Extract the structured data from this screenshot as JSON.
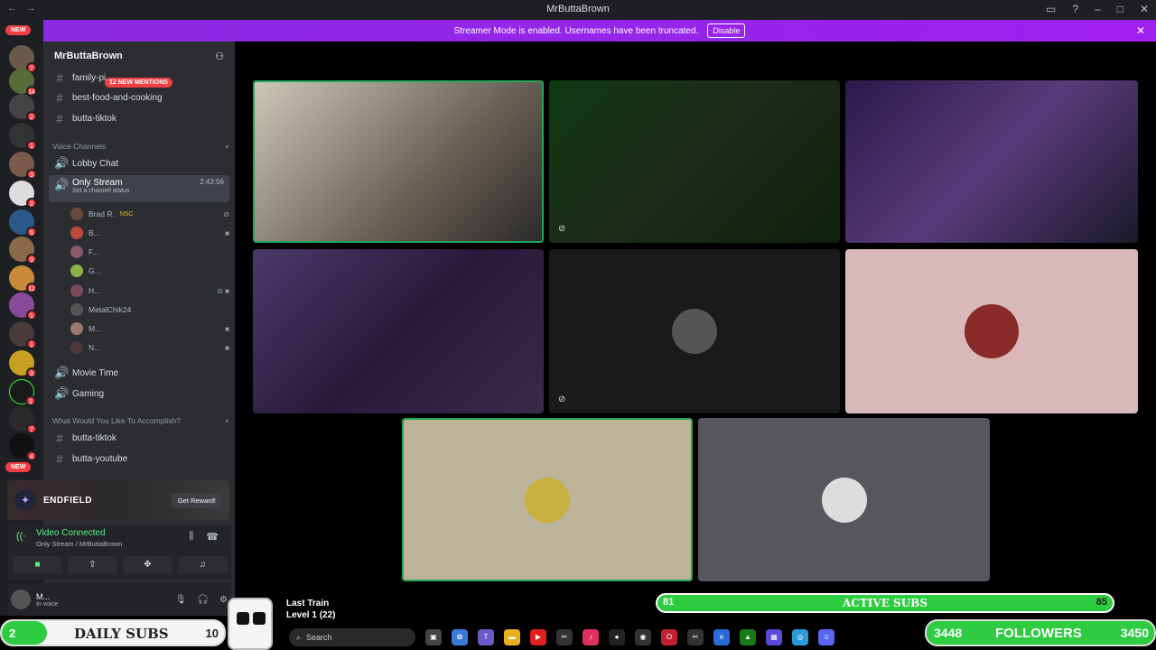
{
  "window": {
    "title": "MrButtaBrown"
  },
  "banner": {
    "text": "Streamer Mode is enabled. Usernames have been truncated.",
    "disable_label": "Disable"
  },
  "servers": {
    "new_label": "NEW",
    "badges": [
      "7",
      "14",
      "2",
      "1",
      "3",
      "2",
      "5",
      "3",
      "12",
      "1",
      "1",
      "3",
      "1",
      "7",
      "4"
    ]
  },
  "guild": {
    "name": "MrButtaBrown"
  },
  "mentions_pill": "12 NEW MENTIONS",
  "channels": {
    "top": [
      "family-pi...",
      "best-food-and-cooking",
      "butta-tiktok"
    ],
    "voice_category": "Voice Channels",
    "lobby": "Lobby Chat",
    "only_stream": "Only Stream",
    "only_stream_status": "Set a channel status",
    "only_stream_time": "2:43:56",
    "voice_users": [
      "Brad R.",
      "B...",
      "F...",
      "G...",
      "H...",
      "MetalChik24",
      "M...",
      "N..."
    ],
    "voice_user_tag": "NSC",
    "movie_time": "Movie Time",
    "gaming": "Gaming",
    "accomplish_category": "What Would You Like To Accomplish?",
    "bottom": [
      "butta-tiktok",
      "butta-youtube"
    ]
  },
  "promo": {
    "name": "ENDFIELD",
    "reward_label": "Get Reward!"
  },
  "rtc": {
    "status": "Video Connected",
    "sub": "Only Stream / MrButtaBrown"
  },
  "user": {
    "name": "M...",
    "status": "In voice"
  },
  "overlay": {
    "daily_subs": {
      "current": "2",
      "label": "DAILY SUBS",
      "goal": "10"
    },
    "active_subs": {
      "current": "81",
      "label": "ACTIVE SUBS",
      "goal": "85"
    },
    "followers": {
      "current": "3448",
      "label": "FOLLOWERS",
      "goal": "3450"
    },
    "train_title": "Last Train",
    "train_level": "Level 1",
    "train_count": "(22)"
  },
  "taskbar": {
    "search_placeholder": "Search"
  },
  "colors": {
    "accent": "#5865f2",
    "speaking": "#23a55a",
    "banner": "#a020f0",
    "goal_fill": "#2ecc40"
  }
}
